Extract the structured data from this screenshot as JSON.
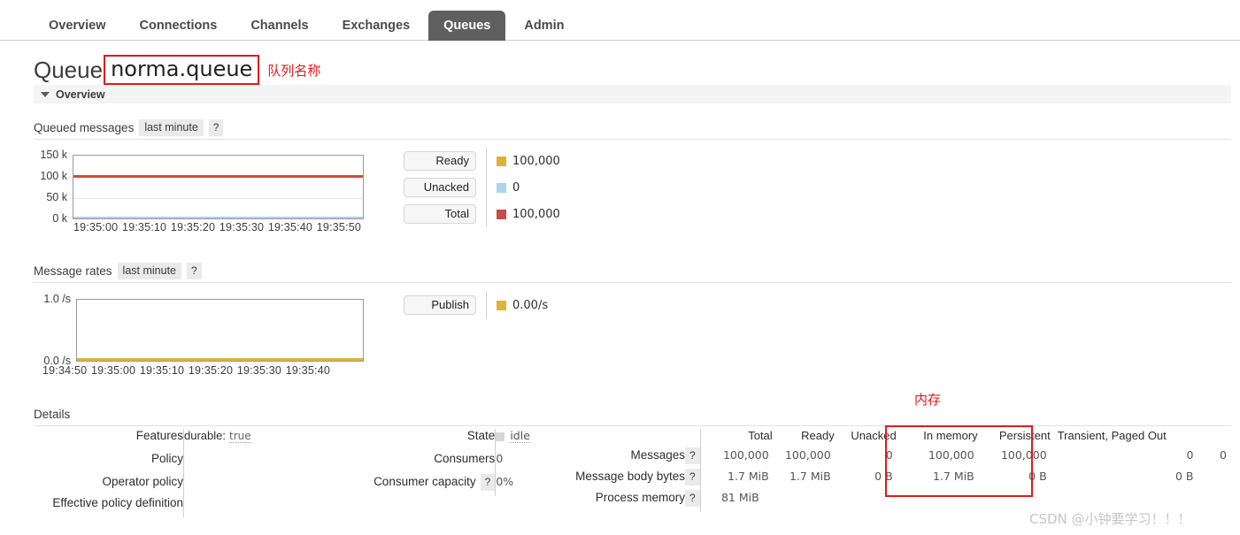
{
  "nav": {
    "tabs": [
      {
        "label": "Overview",
        "active": false
      },
      {
        "label": "Connections",
        "active": false
      },
      {
        "label": "Channels",
        "active": false
      },
      {
        "label": "Exchanges",
        "active": false
      },
      {
        "label": "Queues",
        "active": true
      },
      {
        "label": "Admin",
        "active": false
      }
    ]
  },
  "page": {
    "title": "Queue",
    "queue_name": "norma.queue",
    "queue_name_annotation": "队列名称",
    "memory_annotation": "内存",
    "watermark": "CSDN @小钟要学习！！！"
  },
  "overview_section": {
    "label": "Overview",
    "expanded": true
  },
  "queued_messages": {
    "title": "Queued messages",
    "period_chip": "last minute",
    "help": "?",
    "legend": [
      {
        "button": "Ready",
        "value": "100,000",
        "color": "#e0b13c"
      },
      {
        "button": "Unacked",
        "value": "0",
        "color": "#a8d5f0"
      },
      {
        "button": "Total",
        "value": "100,000",
        "color": "#cc4b42"
      }
    ]
  },
  "message_rates": {
    "title": "Message rates",
    "period_chip": "last minute",
    "help": "?",
    "legend": [
      {
        "button": "Publish",
        "value": "0.00/s",
        "color": "#e0b13c"
      }
    ]
  },
  "details": {
    "title": "Details",
    "left": {
      "rows": [
        {
          "label": "Features",
          "value_key": "durable",
          "value_val": "true"
        },
        {
          "label": "Policy",
          "value_key": "",
          "value_val": ""
        },
        {
          "label": "Operator policy",
          "value_key": "",
          "value_val": ""
        },
        {
          "label": "Effective policy definition",
          "value_key": "",
          "value_val": ""
        }
      ]
    },
    "middle": {
      "rows": [
        {
          "label": "State",
          "help": false,
          "value": "idle"
        },
        {
          "label": "Consumers",
          "help": false,
          "value": "0"
        },
        {
          "label": "Consumer capacity",
          "help": true,
          "value": "0%"
        }
      ]
    },
    "messages_table": {
      "columns": [
        "Total",
        "Ready",
        "Unacked",
        "In memory",
        "Persistent",
        "Transient, Paged Out"
      ],
      "rows": [
        {
          "label": "Messages",
          "help": "?",
          "total": "100,000",
          "ready": "100,000",
          "unacked": "0",
          "in_memory": "100,000",
          "persistent": "100,000",
          "transient": "0",
          "paged_out": "0"
        },
        {
          "label": "Message body bytes",
          "help": "?",
          "total": "1.7 MiB",
          "ready": "1.7 MiB",
          "unacked": "0 B",
          "in_memory": "1.7 MiB",
          "persistent": "0 B",
          "transient": "0 B",
          "paged_out": ""
        },
        {
          "label": "Process memory",
          "help": "?",
          "total": "81 MiB",
          "ready": "",
          "unacked": "",
          "in_memory": "",
          "persistent": "",
          "transient": "",
          "paged_out": ""
        }
      ]
    }
  },
  "chart_data": [
    {
      "type": "line",
      "title": "Queued messages",
      "subtitle": "last minute",
      "xlabel": "",
      "ylabel": "",
      "ylim": [
        0,
        150000
      ],
      "yticks": [
        0,
        50000,
        100000,
        150000
      ],
      "ytick_labels": [
        "0 k",
        "50 k",
        "100 k",
        "150 k"
      ],
      "x": [
        "19:35:00",
        "19:35:10",
        "19:35:20",
        "19:35:30",
        "19:35:40",
        "19:35:50"
      ],
      "grid": true,
      "legend_position": "right",
      "series": [
        {
          "name": "Ready",
          "color": "#e0b13c",
          "values": [
            100000,
            100000,
            100000,
            100000,
            100000,
            100000
          ],
          "current": 100000
        },
        {
          "name": "Unacked",
          "color": "#a8d5f0",
          "values": [
            0,
            0,
            0,
            0,
            0,
            0
          ],
          "current": 0
        },
        {
          "name": "Total",
          "color": "#cc4b42",
          "values": [
            100000,
            100000,
            100000,
            100000,
            100000,
            100000
          ],
          "current": 100000
        }
      ]
    },
    {
      "type": "line",
      "title": "Message rates",
      "subtitle": "last minute",
      "xlabel": "",
      "ylabel": "",
      "ylim": [
        0,
        1.0
      ],
      "yticks": [
        0.0,
        1.0
      ],
      "ytick_labels": [
        "0.0 /s",
        "1.0 /s"
      ],
      "x": [
        "19:34:50",
        "19:35:00",
        "19:35:10",
        "19:35:20",
        "19:35:30",
        "19:35:40"
      ],
      "grid": false,
      "legend_position": "right",
      "series": [
        {
          "name": "Publish",
          "color": "#e0b13c",
          "values": [
            0,
            0,
            0,
            0,
            0,
            0
          ],
          "current": 0.0
        }
      ]
    }
  ]
}
